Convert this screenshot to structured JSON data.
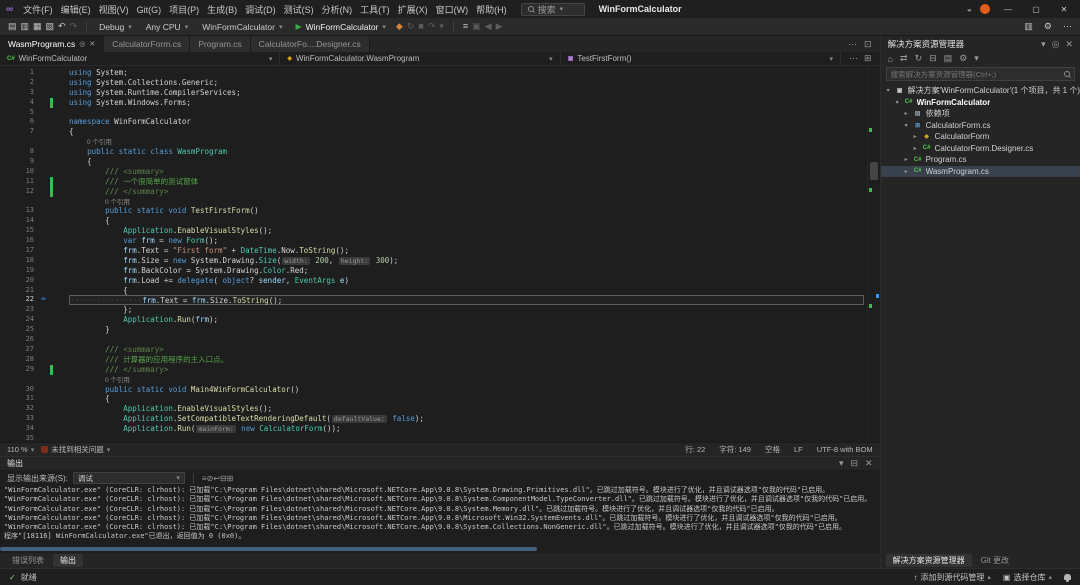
{
  "colors": {
    "accent": "#0078d4",
    "keyword": "#569cd6",
    "type": "#4ec9b0",
    "method": "#dcdcaa",
    "variable": "#9cdcfe",
    "string": "#ce9178",
    "number": "#b5cea8",
    "comment": "#6a9955",
    "run_green": "#3fa94b",
    "change_mark": "#3fb950",
    "csharp_green": "#4ec94b"
  },
  "titlebar": {
    "menus": [
      "文件(F)",
      "编辑(E)",
      "视图(V)",
      "Git(G)",
      "项目(P)",
      "生成(B)",
      "调试(D)",
      "测试(S)",
      "分析(N)",
      "工具(T)",
      "扩展(X)",
      "窗口(W)",
      "帮助(H)"
    ],
    "search_label": "搜索",
    "title": "WinFormCalculator",
    "window_buttons": [
      "—",
      "▢",
      "✕"
    ]
  },
  "toolbar": {
    "left_icons": [
      {
        "name": "new-file-icon",
        "glyph": "▤"
      },
      {
        "name": "open-file-icon",
        "glyph": "▥"
      },
      {
        "name": "save-icon",
        "glyph": "▦"
      },
      {
        "name": "save-all-icon",
        "glyph": "▧"
      },
      {
        "name": "undo-icon",
        "glyph": "↶"
      },
      {
        "name": "redo-icon",
        "glyph": "↷",
        "dim": true
      }
    ],
    "config_dropdown": "Debug",
    "platform_dropdown": "Any CPU",
    "project_dropdown": "WinFormCalculator",
    "run_label": "WinFormCalculator",
    "debug_icons": [
      {
        "name": "hot-reload-icon",
        "glyph": "◆",
        "color": "#d8833a"
      },
      {
        "name": "restart-icon",
        "glyph": "↻",
        "dim": true
      },
      {
        "name": "stop-icon",
        "glyph": "■",
        "dim": true
      },
      {
        "name": "step-over-icon",
        "glyph": "↷",
        "dim": true
      },
      {
        "name": "more-debug-icon",
        "glyph": "▾",
        "dim": true
      }
    ],
    "misc_icons": [
      {
        "name": "find-in-files-icon",
        "glyph": "≡"
      },
      {
        "name": "solution-configurations-icon",
        "glyph": "▣",
        "dim": true
      },
      {
        "name": "navigate-back-icon",
        "glyph": "◀",
        "dim": true
      },
      {
        "name": "navigate-forward-icon",
        "glyph": "▶",
        "dim": true
      }
    ],
    "right_icons": [
      {
        "name": "select-layout-icon",
        "glyph": "▥"
      },
      {
        "name": "settings-gear-icon",
        "glyph": "⚙"
      },
      {
        "name": "more-toolbar-icon",
        "glyph": "⋯"
      }
    ]
  },
  "tab_bar": {
    "tabs": [
      {
        "label": "WasmProgram.cs",
        "active": true
      },
      {
        "label": "CalculatorForm.cs",
        "active": false
      },
      {
        "label": "Program.cs",
        "active": false
      },
      {
        "label": "CalculatorFo....Designer.cs",
        "active": false
      }
    ],
    "right_icons": [
      {
        "name": "more-tabs-icon",
        "glyph": "⋯"
      },
      {
        "name": "split-window-icon",
        "glyph": "⊡"
      }
    ]
  },
  "breadcrumb": {
    "segments": [
      {
        "label": "WinFormCalculator",
        "icon": "csharp"
      },
      {
        "label": "WinFormCalculator.WasmProgram",
        "icon": "class"
      },
      {
        "label": "TestFirstForm()",
        "icon": "method"
      }
    ],
    "right_icons": [
      {
        "name": "more-editor-actions-icon",
        "glyph": "⋯"
      },
      {
        "name": "split-editor-icon",
        "glyph": "⊞"
      }
    ]
  },
  "editor": {
    "lines": [
      {
        "n": 1,
        "s": [
          [
            "k",
            "using"
          ],
          [
            "p",
            " System;"
          ]
        ]
      },
      {
        "n": 2,
        "s": [
          [
            "k",
            "using"
          ],
          [
            "p",
            " System.Collections.Generic;"
          ]
        ]
      },
      {
        "n": 3,
        "s": [
          [
            "k",
            "using"
          ],
          [
            "p",
            " System.Runtime.CompilerServices;"
          ]
        ]
      },
      {
        "n": 4,
        "s": [
          [
            "k",
            "using"
          ],
          [
            "p",
            " System.Windows.Forms;"
          ]
        ],
        "mark": true
      },
      {
        "n": 5,
        "s": []
      },
      {
        "n": 6,
        "s": [
          [
            "k",
            "namespace"
          ],
          [
            "p",
            " WinFormCalculator"
          ]
        ]
      },
      {
        "n": 7,
        "s": [
          [
            "p",
            "{"
          ]
        ]
      },
      {
        "lens": "0 个引用",
        "ind": 4
      },
      {
        "n": 8,
        "s": [
          [
            "p",
            "    "
          ],
          [
            "k",
            "public static class"
          ],
          [
            "t",
            " WasmProgram"
          ]
        ]
      },
      {
        "n": 9,
        "s": [
          [
            "p",
            "    {"
          ]
        ]
      },
      {
        "n": 10,
        "s": [
          [
            "c",
            "        /// "
          ],
          [
            "cg",
            "<summary>"
          ]
        ]
      },
      {
        "n": 11,
        "s": [
          [
            "c",
            "        /// "
          ],
          [
            "c2",
            "一个很简单的测试窗体"
          ]
        ],
        "mark": true
      },
      {
        "n": 12,
        "s": [
          [
            "c",
            "        /// "
          ],
          [
            "cg",
            "</summary>"
          ]
        ],
        "mark": true
      },
      {
        "lens": "0 个引用",
        "ind": 8
      },
      {
        "n": 13,
        "s": [
          [
            "p",
            "        "
          ],
          [
            "k",
            "public static void"
          ],
          [
            "m",
            " TestFirstForm"
          ],
          [
            "p",
            "()"
          ]
        ]
      },
      {
        "n": 14,
        "s": [
          [
            "p",
            "        {"
          ]
        ]
      },
      {
        "n": 15,
        "s": [
          [
            "p",
            "            "
          ],
          [
            "t",
            "Application"
          ],
          [
            "p",
            "."
          ],
          [
            "m",
            "EnableVisualStyles"
          ],
          [
            "p",
            "();"
          ]
        ]
      },
      {
        "n": 16,
        "s": [
          [
            "p",
            "            "
          ],
          [
            "k",
            "var"
          ],
          [
            "v",
            " frm"
          ],
          [
            "p",
            " = "
          ],
          [
            "k",
            "new"
          ],
          [
            "t",
            " Form"
          ],
          [
            "p",
            "();"
          ]
        ]
      },
      {
        "n": 17,
        "s": [
          [
            "p",
            "            "
          ],
          [
            "v",
            "frm"
          ],
          [
            "p",
            ".Text = "
          ],
          [
            "s",
            "\"First form\""
          ],
          [
            "p",
            " + "
          ],
          [
            "t",
            "DateTime"
          ],
          [
            "p",
            ".Now."
          ],
          [
            "m",
            "ToString"
          ],
          [
            "p",
            "();"
          ]
        ]
      },
      {
        "n": 18,
        "s": [
          [
            "p",
            "            "
          ],
          [
            "v",
            "frm"
          ],
          [
            "p",
            ".Size = "
          ],
          [
            "k",
            "new"
          ],
          [
            "p",
            " System.Drawing."
          ],
          [
            "t",
            "Size"
          ],
          [
            "p",
            "("
          ],
          [
            "h",
            "width:"
          ],
          [
            "n2",
            " 200"
          ],
          [
            "p",
            ", "
          ],
          [
            "h",
            "height:"
          ],
          [
            "n2",
            " 300"
          ],
          [
            "p",
            ");"
          ]
        ]
      },
      {
        "n": 19,
        "s": [
          [
            "p",
            "            "
          ],
          [
            "v",
            "frm"
          ],
          [
            "p",
            ".BackColor = System.Drawing."
          ],
          [
            "t",
            "Color"
          ],
          [
            "p",
            ".Red;"
          ]
        ]
      },
      {
        "n": 20,
        "s": [
          [
            "p",
            "            "
          ],
          [
            "v",
            "frm"
          ],
          [
            "p",
            ".Load += "
          ],
          [
            "k",
            "delegate"
          ],
          [
            "p",
            "( "
          ],
          [
            "k",
            "object"
          ],
          [
            "p",
            "? "
          ],
          [
            "v",
            "sender"
          ],
          [
            "p",
            ", "
          ],
          [
            "t",
            "EventArgs"
          ],
          [
            "v",
            " e"
          ],
          [
            "p",
            ")"
          ]
        ]
      },
      {
        "n": 21,
        "s": [
          [
            "p",
            "            {"
          ]
        ]
      },
      {
        "n": 22,
        "hl": true,
        "bookmark": true,
        "s": [
          [
            "ws",
            "················"
          ],
          [
            "v",
            "frm"
          ],
          [
            "p",
            ".Text = "
          ],
          [
            "v",
            "frm"
          ],
          [
            "p",
            ".Size."
          ],
          [
            "m",
            "ToString"
          ],
          [
            "p",
            "();"
          ]
        ]
      },
      {
        "n": 23,
        "s": [
          [
            "p",
            "            };"
          ]
        ]
      },
      {
        "n": 24,
        "s": [
          [
            "p",
            "            "
          ],
          [
            "t",
            "Application"
          ],
          [
            "p",
            "."
          ],
          [
            "m",
            "Run"
          ],
          [
            "p",
            "("
          ],
          [
            "v",
            "frm"
          ],
          [
            "p",
            ");"
          ]
        ]
      },
      {
        "n": 25,
        "s": [
          [
            "p",
            "        }"
          ]
        ]
      },
      {
        "n": 26,
        "s": []
      },
      {
        "n": 27,
        "s": [
          [
            "c",
            "        /// "
          ],
          [
            "cg",
            "<summary>"
          ]
        ]
      },
      {
        "n": 28,
        "s": [
          [
            "c",
            "        /// "
          ],
          [
            "c2",
            "计算器的应用程序的主入口点。"
          ]
        ]
      },
      {
        "n": 29,
        "s": [
          [
            "c",
            "        /// "
          ],
          [
            "cg",
            "</summary>"
          ]
        ],
        "mark": true
      },
      {
        "lens": "0 个引用",
        "ind": 8
      },
      {
        "n": 30,
        "s": [
          [
            "p",
            "        "
          ],
          [
            "k",
            "public static void"
          ],
          [
            "m",
            " Main4WinFormCalculator"
          ],
          [
            "p",
            "()"
          ]
        ]
      },
      {
        "n": 31,
        "s": [
          [
            "p",
            "        {"
          ]
        ]
      },
      {
        "n": 32,
        "s": [
          [
            "p",
            "            "
          ],
          [
            "t",
            "Application"
          ],
          [
            "p",
            "."
          ],
          [
            "m",
            "EnableVisualStyles"
          ],
          [
            "p",
            "();"
          ]
        ]
      },
      {
        "n": 33,
        "s": [
          [
            "p",
            "            "
          ],
          [
            "t",
            "Application"
          ],
          [
            "p",
            "."
          ],
          [
            "m",
            "SetCompatibleTextRenderingDefault"
          ],
          [
            "p",
            "("
          ],
          [
            "h",
            "defaultValue:"
          ],
          [
            "k",
            " false"
          ],
          [
            "p",
            ");"
          ]
        ]
      },
      {
        "n": 34,
        "s": [
          [
            "p",
            "            "
          ],
          [
            "t",
            "Application"
          ],
          [
            "p",
            "."
          ],
          [
            "m",
            "Run"
          ],
          [
            "p",
            "("
          ],
          [
            "h",
            "mainForm:"
          ],
          [
            "k",
            " new"
          ],
          [
            "t",
            " CalculatorForm"
          ],
          [
            "p",
            "());"
          ]
        ]
      },
      {
        "n": 35,
        "s": []
      }
    ],
    "status_bar": {
      "zoom": "110 %",
      "health": "未找到相关问题",
      "line": "行: 22",
      "column": "字符: 149",
      "spaces": "空格",
      "line_ending": "LF",
      "encoding": "UTF-8 with BOM"
    }
  },
  "output_panel": {
    "title": "输出",
    "header_icons": [
      {
        "name": "chevron-down-icon",
        "glyph": "▾"
      },
      {
        "name": "float-panel-icon",
        "glyph": "⊟"
      },
      {
        "name": "close-icon",
        "glyph": "✕"
      }
    ],
    "source_label": "显示输出来源(S):",
    "source_value": "调试",
    "toolbar_icons": [
      {
        "name": "find-message-icon",
        "glyph": "≡"
      },
      {
        "name": "clear-all-icon",
        "glyph": "⊘"
      },
      {
        "name": "word-wrap-icon",
        "glyph": "↩"
      },
      {
        "name": "collapse-all-icon",
        "glyph": "⊟"
      },
      {
        "name": "expand-all-icon",
        "glyph": "⊞"
      }
    ],
    "lines": [
      "\"WinFormCalculator.exe\" (CoreCLR: clrhost): 已加载\"C:\\Program Files\\dotnet\\shared\\Microsoft.NETCore.App\\9.0.8\\System.Drawing.Primitives.dll\"。已跳过加载符号。模块进行了优化，并且调试器选项\"仅我的代码\"已启用。",
      "\"WinFormCalculator.exe\" (CoreCLR: clrhost): 已加载\"C:\\Program Files\\dotnet\\shared\\Microsoft.NETCore.App\\9.0.8\\System.ComponentModel.TypeConverter.dll\"。已跳过加载符号。模块进行了优化，并且调试器选项\"仅我的代码\"已启用。",
      "\"WinFormCalculator.exe\" (CoreCLR: clrhost): 已加载\"C:\\Program Files\\dotnet\\shared\\Microsoft.NETCore.App\\9.0.8\\System.Memory.dll\"。已跳过加载符号。模块进行了优化，并且调试器选项\"仅我的代码\"已启用。",
      "\"WinFormCalculator.exe\" (CoreCLR: clrhost): 已加载\"C:\\Program Files\\dotnet\\shared\\Microsoft.NETCore.App\\9.0.8\\Microsoft.Win32.SystemEvents.dll\"。已跳过加载符号。模块进行了优化，并且调试器选项\"仅我的代码\"已启用。",
      "\"WinFormCalculator.exe\" (CoreCLR: clrhost): 已加载\"C:\\Program Files\\dotnet\\shared\\Microsoft.NETCore.App\\9.0.8\\System.Collections.NonGeneric.dll\"。已跳过加载符号。模块进行了优化，并且调试器选项\"仅我的代码\"已启用。",
      "程序\"[18116] WinFormCalculator.exe\"已退出，返回值为 0 (0x0)。"
    ]
  },
  "panel_tabs": {
    "tabs": [
      "错误列表",
      "输出"
    ],
    "active": "输出"
  },
  "solution_explorer": {
    "title": "解决方案资源管理器",
    "header_icons": [
      {
        "name": "chevron-down-icon",
        "glyph": "▾"
      },
      {
        "name": "pin-icon",
        "glyph": "◎"
      },
      {
        "name": "close-icon",
        "glyph": "✕"
      }
    ],
    "toolbar_icons": [
      {
        "name": "home-icon",
        "glyph": "⌂"
      },
      {
        "name": "switch-views-icon",
        "glyph": "⇄"
      },
      {
        "name": "refresh-icon",
        "glyph": "↻"
      },
      {
        "name": "collapse-all-icon",
        "glyph": "⊟"
      },
      {
        "name": "show-all-files-icon",
        "glyph": "▤"
      },
      {
        "name": "properties-icon",
        "glyph": "⚙"
      },
      {
        "name": "more-options-icon",
        "glyph": "▾"
      }
    ],
    "search_placeholder": "搜索解决方案资源管理器(Ctrl+;)",
    "tree": [
      {
        "label": "解决方案'WinFormCalculator'(1 个项目，共 1 个)",
        "ind": 0,
        "icon": "solution",
        "exp": true
      },
      {
        "label": "WinFormCalculator",
        "ind": 1,
        "icon": "csproj",
        "exp": true,
        "bold": true
      },
      {
        "label": "依赖项",
        "ind": 2,
        "icon": "deps",
        "exp": false
      },
      {
        "label": "CalculatorForm.cs",
        "ind": 2,
        "icon": "form",
        "exp": true
      },
      {
        "label": "CalculatorForm",
        "ind": 3,
        "icon": "class",
        "exp": false
      },
      {
        "label": "CalculatorForm.Designer.cs",
        "ind": 3,
        "icon": "cs",
        "exp": false
      },
      {
        "label": "Program.cs",
        "ind": 2,
        "icon": "cs",
        "exp": false
      },
      {
        "label": "WasmProgram.cs",
        "ind": 2,
        "icon": "cs",
        "exp": false,
        "selected": true
      }
    ],
    "bottom_tabs": [
      "解决方案资源管理器",
      "Git 更改"
    ],
    "bottom_active": "解决方案资源管理器"
  },
  "status_bar": {
    "ready": "就绪",
    "add_to_source_control": "添加到源代码管理",
    "select_repository": "选择仓库"
  }
}
